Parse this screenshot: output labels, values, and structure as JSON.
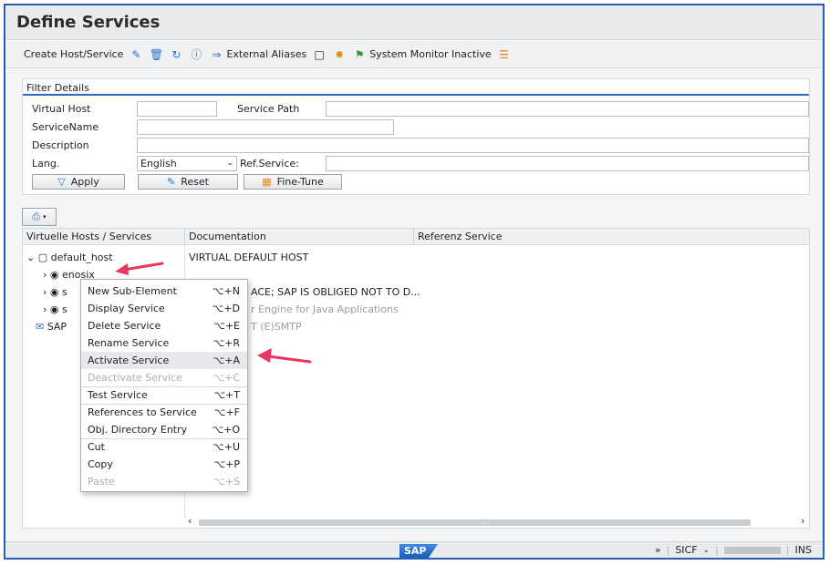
{
  "window": {
    "title": "Define Services"
  },
  "toolbar": {
    "create_label": "Create Host/Service",
    "external_aliases_label": "External Aliases",
    "system_monitor_label": "System Monitor Inactive"
  },
  "filter": {
    "heading": "Filter Details",
    "virtual_host_label": "Virtual Host",
    "virtual_host_value": "",
    "service_path_label": "Service Path",
    "service_path_value": "",
    "service_name_label": "ServiceName",
    "service_name_value": "",
    "description_label": "Description",
    "description_value": "",
    "lang_label": "Lang.",
    "lang_value": "English",
    "ref_service_label": "Ref.Service:",
    "ref_service_value": "",
    "apply_label": "Apply",
    "reset_label": "Reset",
    "fine_tune_label": "Fine-Tune"
  },
  "tree": {
    "columns": [
      "Virtuelle Hosts / Services",
      "Documentation",
      "Referenz Service"
    ],
    "rows": [
      {
        "name": "default_host",
        "doc": "VIRTUAL DEFAULT HOST"
      },
      {
        "name": "enosix",
        "doc": ""
      },
      {
        "name": "s",
        "doc": "ACE; SAP IS OBLIGED NOT TO D..."
      },
      {
        "name": "s",
        "doc": "r Engine for Java Applications"
      },
      {
        "name": "SAP",
        "doc": "T (E)SMTP"
      }
    ]
  },
  "context_menu": {
    "items": [
      {
        "label": "New Sub-Element",
        "shortcut": "⌥+N"
      },
      {
        "label": "Display Service",
        "shortcut": "⌥+D"
      },
      {
        "label": "Delete Service",
        "shortcut": "⌥+E"
      },
      {
        "label": "Rename Service",
        "shortcut": "⌥+R"
      },
      {
        "label": "Activate Service",
        "shortcut": "⌥+A"
      },
      {
        "label": "Deactivate Service",
        "shortcut": "⌥+C"
      },
      {
        "label": "Test Service",
        "shortcut": "⌥+T"
      },
      {
        "label": "References to Service",
        "shortcut": "⌥+F"
      },
      {
        "label": "Obj. Directory Entry",
        "shortcut": "⌥+O"
      },
      {
        "label": "Cut",
        "shortcut": "⌥+U"
      },
      {
        "label": "Copy",
        "shortcut": "⌥+P"
      },
      {
        "label": "Paste",
        "shortcut": "⌥+S"
      }
    ]
  },
  "status": {
    "logo": "SAP",
    "chevrons": "»",
    "transaction": "SICF",
    "mode": "INS"
  },
  "colors": {
    "accent": "#2a6fc7",
    "arrow": "#e8385f",
    "frame": "#2a5bb8"
  }
}
